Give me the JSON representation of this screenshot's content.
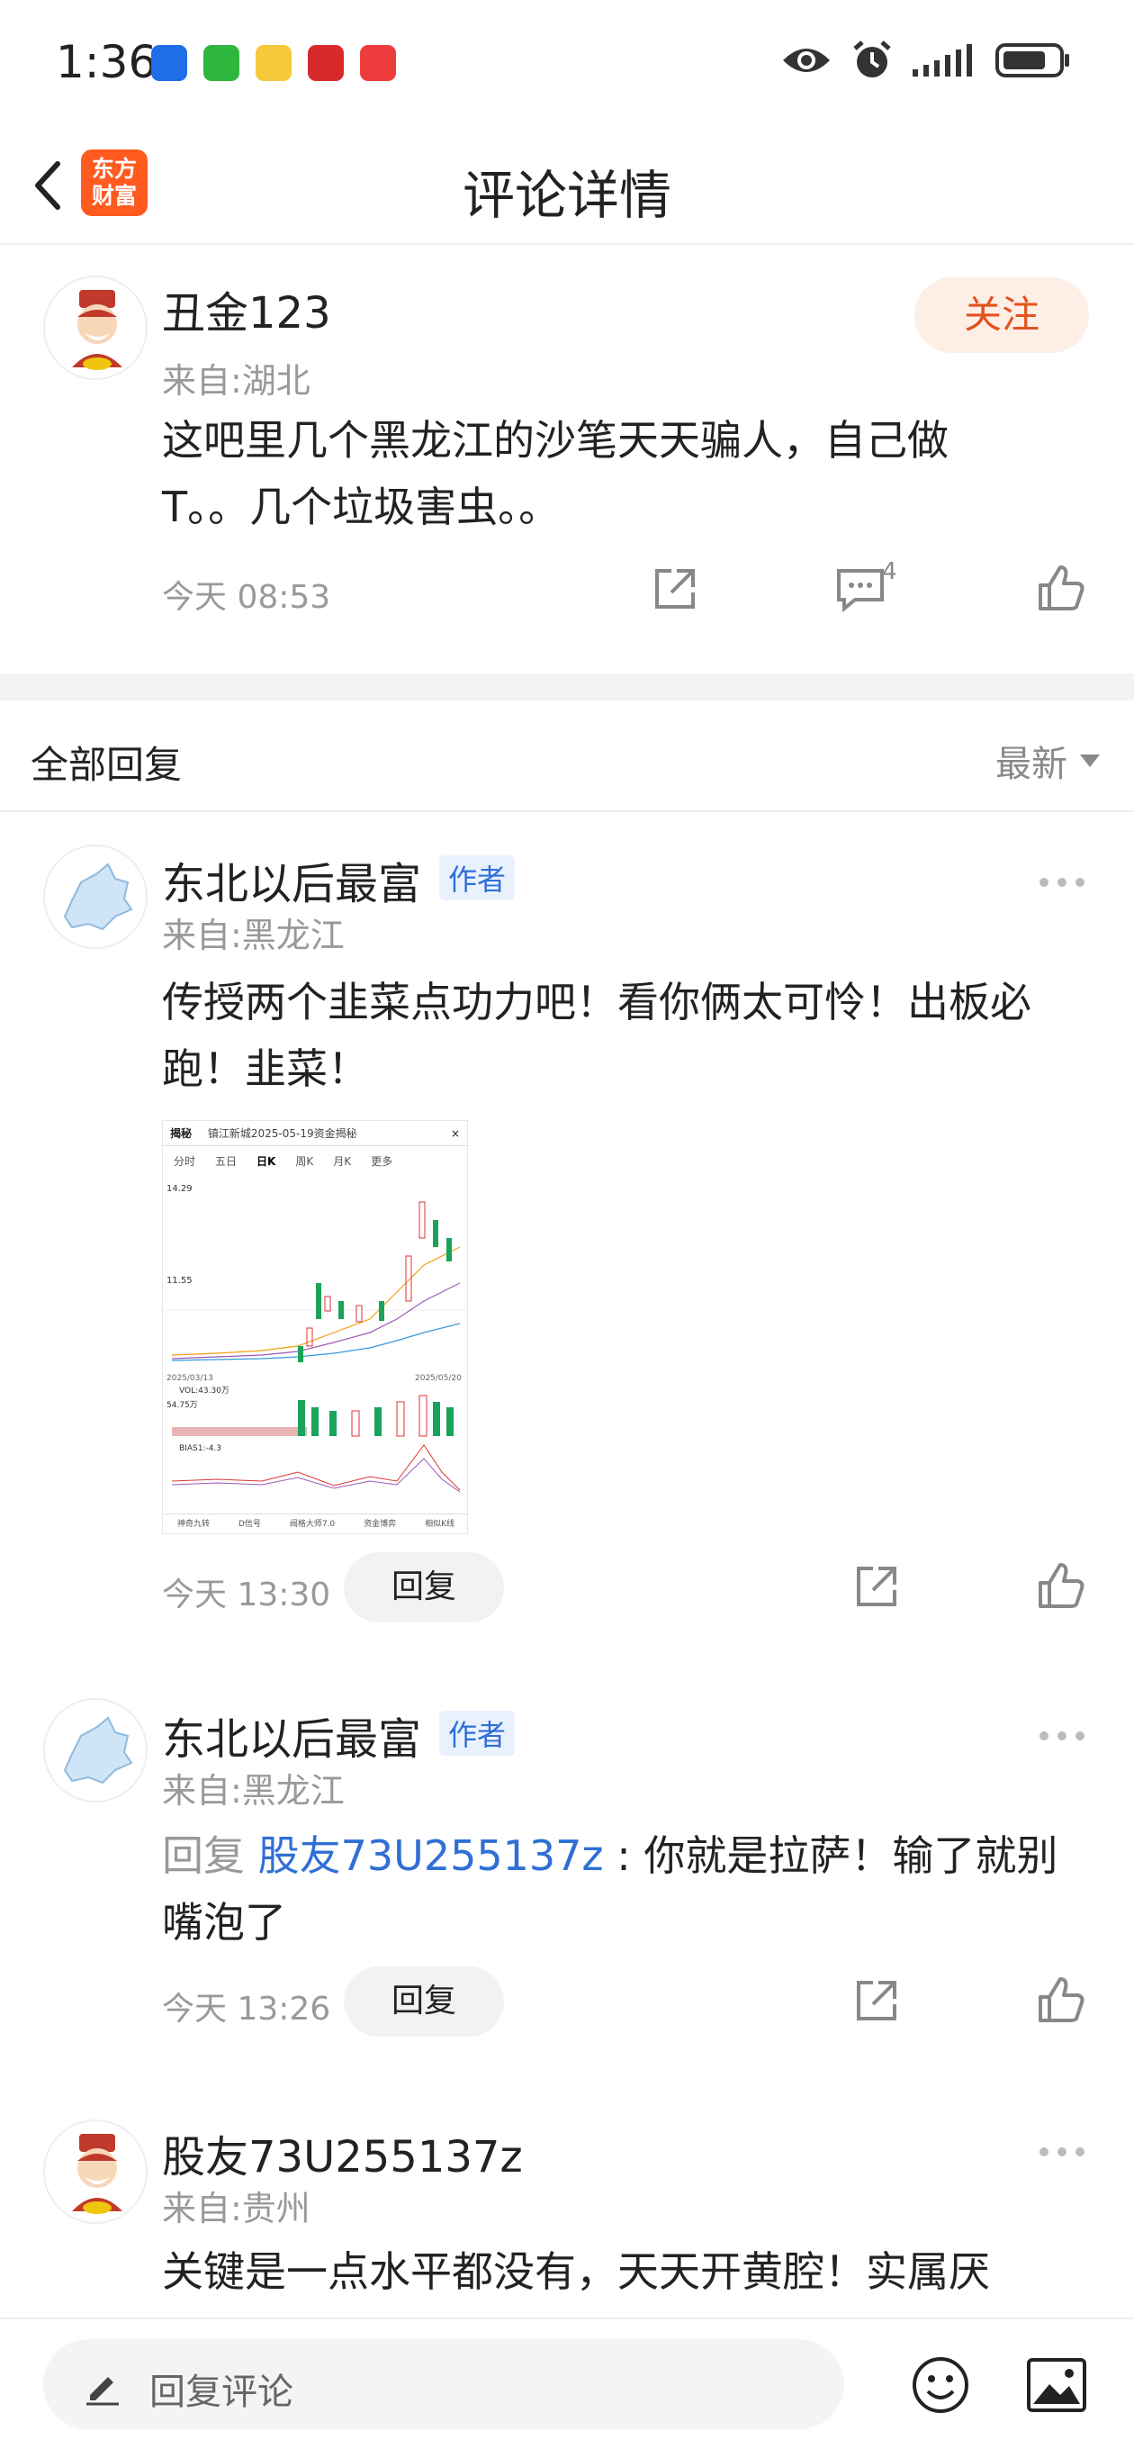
{
  "status_bar": {
    "time": "1:36",
    "app_icons": [
      "email-app-icon",
      "wechat-icon",
      "squirrel-app-icon",
      "bank-app-icon",
      "red-app-icon"
    ],
    "right_icons": [
      "eye-icon",
      "alarm-icon",
      "signal-icon",
      "battery-icon"
    ]
  },
  "header": {
    "title": "评论详情",
    "logo_line1": "东方",
    "logo_line2": "财富"
  },
  "main_comment": {
    "username": "丑金123",
    "location": "来自:湖北",
    "text_line1": "这吧里几个黑龙江的沙笔天天骗人，自己做",
    "text_line2": "T。。几个垃圾害虫。。",
    "time": "今天 08:53",
    "follow_label": "关注",
    "comment_count": "4"
  },
  "replies_header": {
    "title": "全部回复",
    "sort": "最新"
  },
  "replies": [
    {
      "username": "东北以后最富",
      "badge": "作者",
      "location": "来自:黑龙江",
      "text_line1": "传授两个韭菜点功力吧！看你俩太可怜！出板必",
      "text_line2": "跑！韭菜！",
      "time": "今天 13:30",
      "reply_label": "回复"
    },
    {
      "username": "东北以后最富",
      "badge": "作者",
      "location": "来自:黑龙江",
      "reply_prefix": "回复 ",
      "reply_to": "股友73U255137z",
      "text_rest": " : 你就是拉萨！输了就别",
      "text_line2": "嘴泡了",
      "time": "今天 13:26",
      "reply_label": "回复"
    },
    {
      "username": "股友73U255137z",
      "location": "来自:贵州",
      "text_line1": "关键是一点水平都没有，天天开黄腔！实属厌"
    }
  ],
  "thumbnail": {
    "tab": "揭秘",
    "title": "镇江新城2025-05-19资金揭秘",
    "periods": [
      "分时",
      "五日",
      "日K",
      "周K",
      "月K",
      "更多"
    ],
    "price_high": "14.29",
    "price_mid": "11.55",
    "date_start": "2025/03/13",
    "date_end": "2025/05/20",
    "vol_label": "VOL:43.30万",
    "vol_value": "54.75万",
    "bias_label": "BIAS1:-4.3",
    "footer": [
      "神奇九转",
      "D信号",
      "阀格大师7.0",
      "资金博弈",
      "相似K线"
    ]
  },
  "bottom_bar": {
    "placeholder": "回复评论"
  }
}
